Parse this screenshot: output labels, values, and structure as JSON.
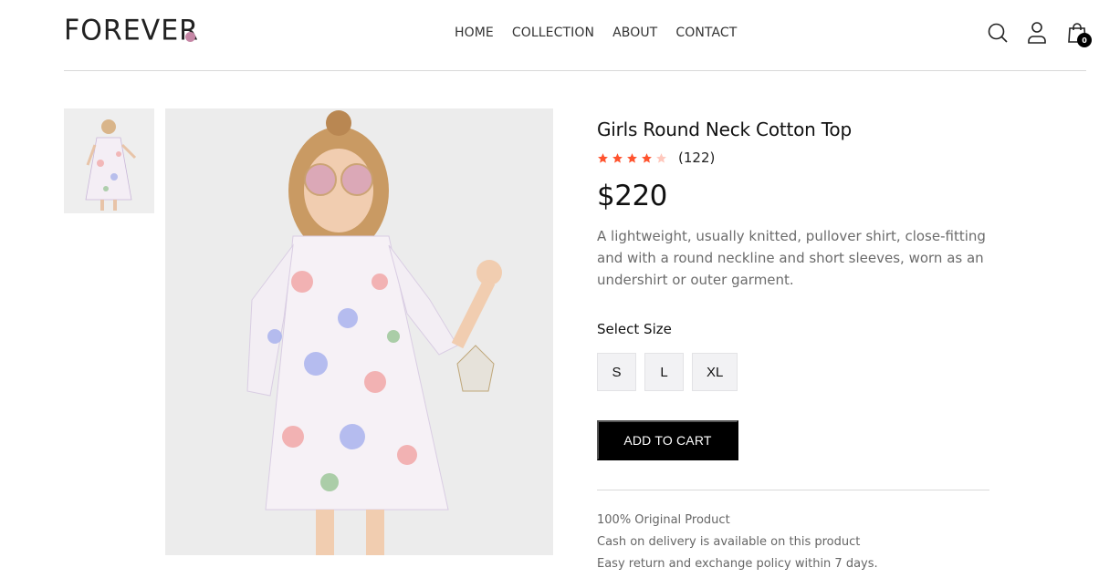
{
  "brand": {
    "logo_text": "FOREVER",
    "accent_color": "#c586a5"
  },
  "nav": {
    "items": [
      {
        "label": "HOME"
      },
      {
        "label": "COLLECTION"
      },
      {
        "label": "ABOUT"
      },
      {
        "label": "CONTACT"
      }
    ]
  },
  "header_icons": {
    "search": "search-icon",
    "profile": "profile-icon",
    "cart": "cart-icon",
    "cart_count": "0"
  },
  "product": {
    "title": "Girls Round Neck Cotton Top",
    "rating": {
      "stars_filled": 4,
      "stars_total": 5,
      "count_text": "(122)",
      "star_color": "#ff532e"
    },
    "price": "$220",
    "description": "A lightweight, usually knitted, pullover shirt, close-fitting and with a round neckline and short sleeves, worn as an undershirt or outer garment.",
    "size_label": "Select Size",
    "sizes": [
      "S",
      "L",
      "XL"
    ],
    "add_to_cart": "ADD TO CART",
    "policies": [
      "100% Original Product",
      "Cash on delivery is available on this product",
      "Easy return and exchange policy within 7 days."
    ]
  }
}
